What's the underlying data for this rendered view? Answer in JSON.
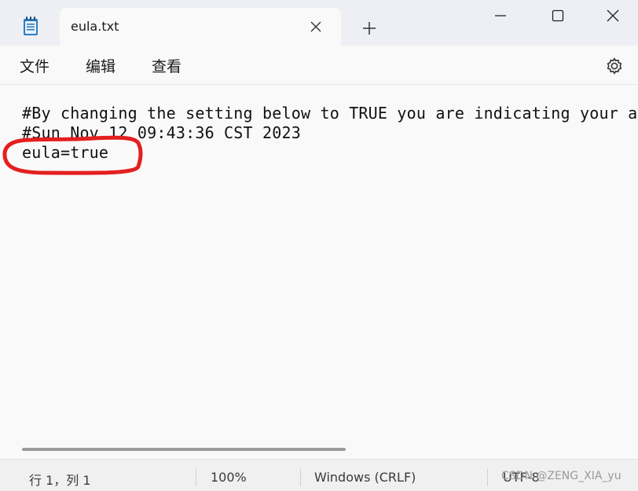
{
  "tab": {
    "title": "eula.txt"
  },
  "menu": {
    "file": "文件",
    "edit": "编辑",
    "view": "查看"
  },
  "editor": {
    "lines": [
      "#By changing the setting below to TRUE you are indicating your agr",
      "#Sun Nov 12 09:43:36 CST 2023",
      "eula=true"
    ]
  },
  "status": {
    "position": "行 1，列 1",
    "zoom": "100%",
    "line_ending": "Windows (CRLF)",
    "encoding": "UTF-8"
  },
  "watermark": "CSDN @ZENG_XIA_yu",
  "colors": {
    "annotation": "#e41f1f",
    "titlebar": "#eeeff4",
    "background": "#f9f9f9"
  },
  "icons": {
    "app": "notepad-icon",
    "close_tab": "close-icon",
    "new_tab": "plus-icon",
    "minimize": "minimize-icon",
    "maximize": "maximize-icon",
    "close_window": "close-icon",
    "settings": "gear-icon"
  }
}
